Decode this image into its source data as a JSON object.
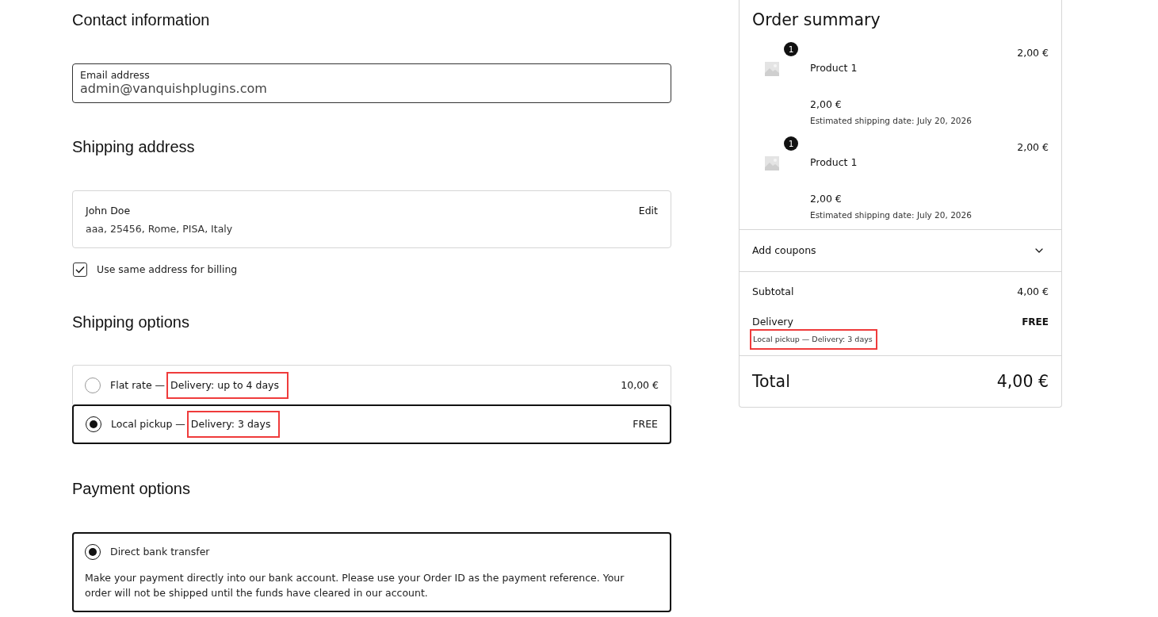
{
  "contact": {
    "heading": "Contact information",
    "email": {
      "label": "Email address",
      "value": "admin@vanquishplugins.com"
    }
  },
  "shipping_address": {
    "heading": "Shipping address",
    "name": "John Doe",
    "address": "aaa, 25456, Rome, PISA, Italy",
    "edit": "Edit",
    "billing_checkbox": {
      "label": "Use same address for billing",
      "checked": true
    }
  },
  "shipping_options": {
    "heading": "Shipping options",
    "options": [
      {
        "name": "Flat rate —",
        "detail": "Delivery: up to 4 days",
        "highlighted": true,
        "price": "10,00 €",
        "selected": false
      },
      {
        "name": "Local pickup —",
        "detail": "Delivery: 3 days",
        "highlighted": true,
        "price": "FREE",
        "selected": true
      }
    ]
  },
  "payment_options": {
    "heading": "Payment options",
    "methods": [
      {
        "name": "Direct bank transfer",
        "selected": true,
        "description": "Make your payment directly into our bank account. Please use your Order ID as the payment reference. Your order will not be shipped until the funds have cleared in our account."
      }
    ]
  },
  "order_summary": {
    "title": "Order summary",
    "items": [
      {
        "quantity": "1",
        "name": "Product 1",
        "price": "2,00 €",
        "unit_price": "2,00 €",
        "shipping_date": "Estimated shipping date: July 20, 2026"
      },
      {
        "quantity": "1",
        "name": "Product 1",
        "price": "2,00 €",
        "unit_price": "2,00 €",
        "shipping_date": "Estimated shipping date: July 20, 2026"
      }
    ],
    "coupons": {
      "label": "Add coupons",
      "expanded": false
    },
    "subtotal": {
      "label": "Subtotal",
      "value": "4,00 €"
    },
    "delivery": {
      "label": "Delivery",
      "value": "FREE",
      "detail": "Local pickup — Delivery: 3 days",
      "highlighted": true
    },
    "total": {
      "label": "Total",
      "value": "4,00 €"
    }
  }
}
